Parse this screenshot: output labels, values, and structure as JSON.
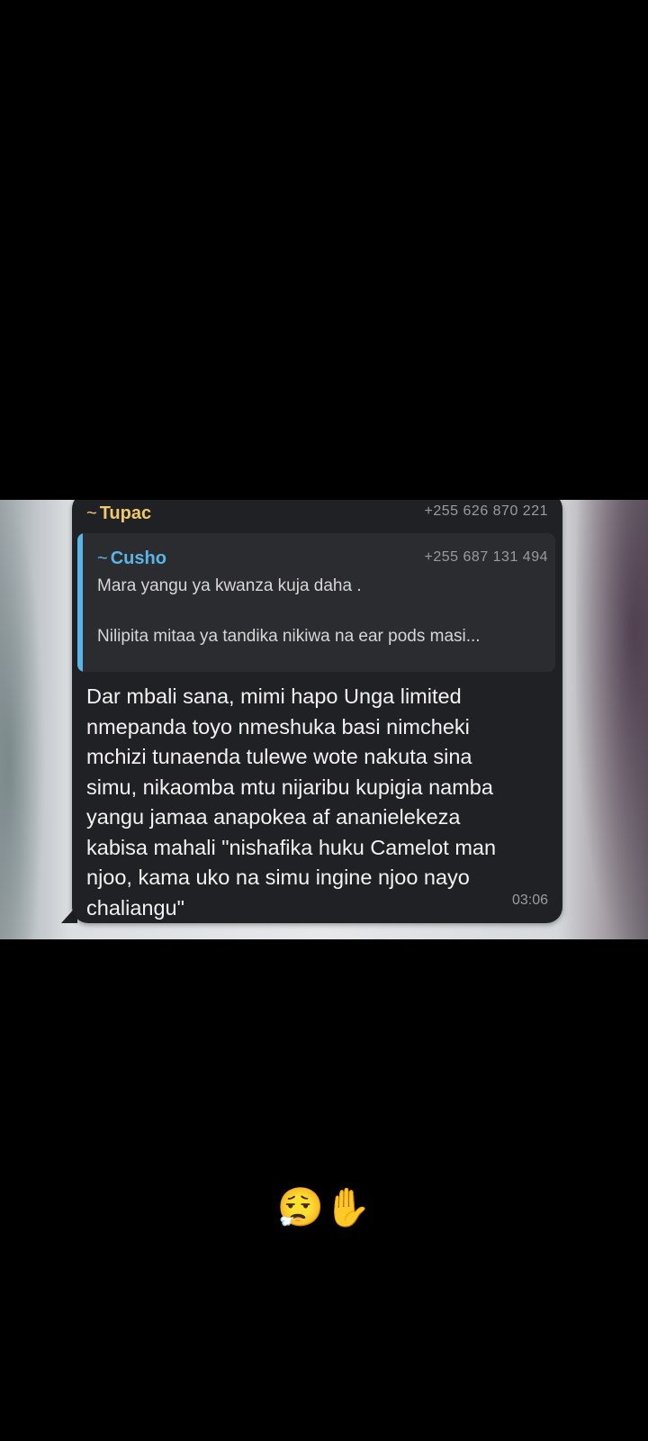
{
  "forwarded_message": {
    "sender": {
      "tilde": "~",
      "name": "Tupac",
      "phone": "+255 626 870 221",
      "color": "#f0c86b"
    },
    "quoted": {
      "tilde": "~",
      "name": "Cusho",
      "phone": "+255 687 131 494",
      "line1": "Mara yangu ya kwanza kuja daha .",
      "line2": "Nilipita mitaa ya tandika nikiwa na ear pods masi...",
      "accent_color": "#5ab5e6"
    },
    "body": "Dar mbali sana, mimi hapo Unga limited\nnmepanda toyo nmeshuka basi nimcheki\nmchizi tunaenda tulewe wote nakuta sina\nsimu, nikaomba mtu nijaribu kupigia namba\nyangu jamaa anapokea af ananielekeza\nkabisa mahali \"nishafika huku Camelot man\nnjoo, kama uko na simu ingine njoo nayo\nchaliangu\"",
    "time": "03:06"
  },
  "caption": {
    "emojis": "😮‍💨✋"
  }
}
